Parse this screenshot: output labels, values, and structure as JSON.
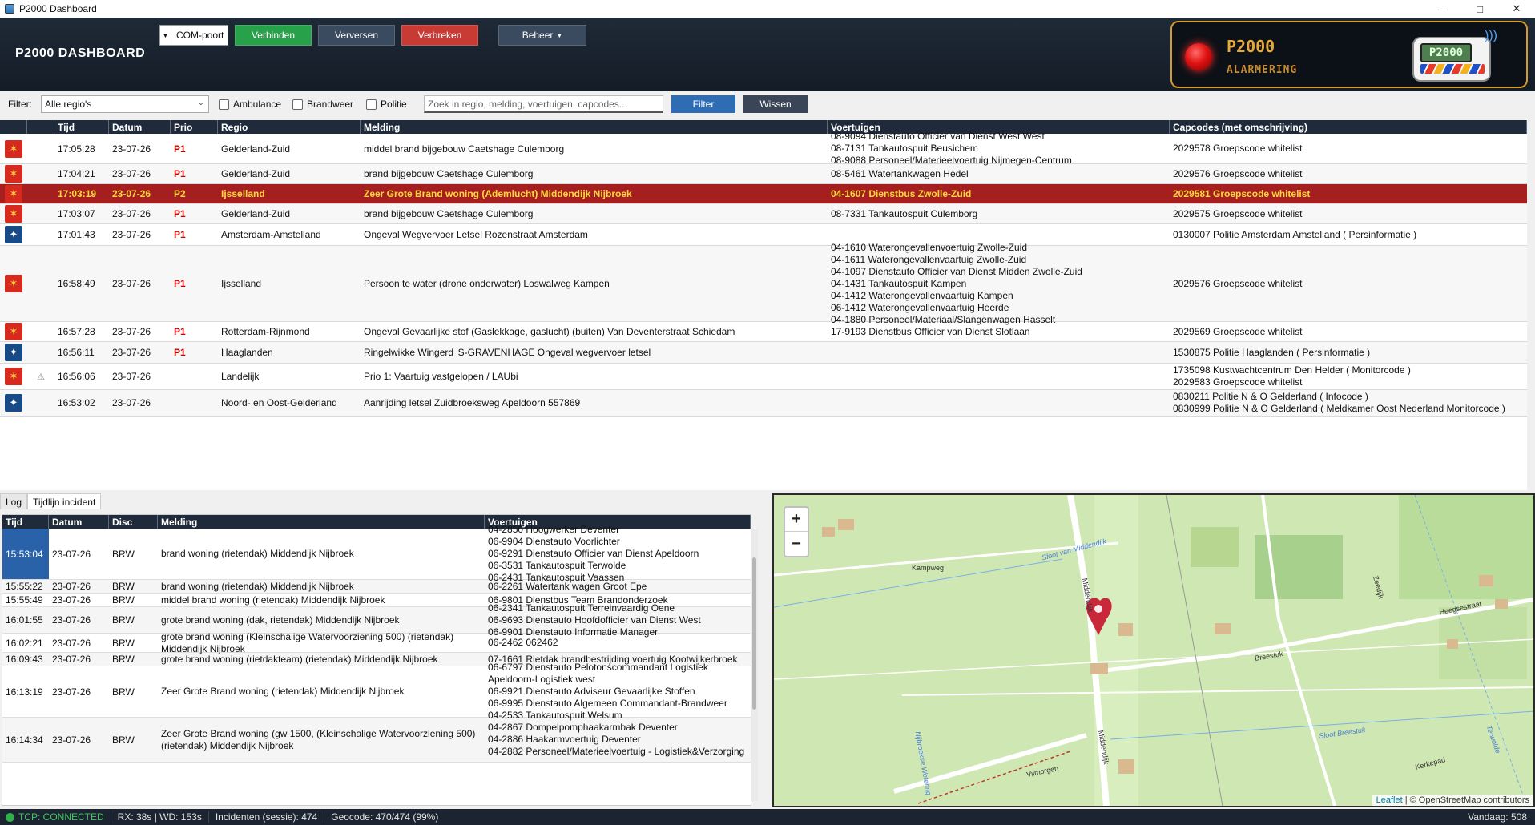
{
  "window": {
    "title": "P2000 Dashboard",
    "controls": [
      "—",
      "□",
      "✕"
    ]
  },
  "header": {
    "brand": "P2000  DASHBOARD",
    "com_port": "COM-poort",
    "btn_connect": "Verbinden",
    "btn_refresh": "Verversen",
    "btn_disconnect": "Verbreken",
    "btn_manage": "Beheer",
    "alarm_title": "P2000",
    "alarm_subtitle": "ALARMERING",
    "pager_screen": "P2000"
  },
  "filter": {
    "label": "Filter:",
    "region_select": "Alle regio's",
    "chk_ambulance": "Ambulance",
    "chk_brandweer": "Brandweer",
    "chk_politie": "Politie",
    "search_placeholder": "Zoek in regio, melding, voertuigen, capcodes...",
    "btn_filter": "Filter",
    "btn_clear": "Wissen"
  },
  "main_table": {
    "headers": {
      "time": "Tijd",
      "date": "Datum",
      "prio": "Prio",
      "region": "Regio",
      "message": "Melding",
      "vehicles": "Voertuigen",
      "capcodes": "Capcodes (met omschrijving)"
    },
    "rows": [
      {
        "icon": "brandweer-icon",
        "time": "17:05:28",
        "date": "23-07-26",
        "prio": "P1",
        "region": "Gelderland-Zuid",
        "message": "middel brand bijgebouw Caetshage Culemborg",
        "vehicles": [
          "08-9094 Dienstauto Officier van Dienst West West",
          "08-7131 Tankautospuit Beusichem",
          "08-9088 Personeel/Materieelvoertuig Nijmegen-Centrum"
        ],
        "capcodes": [
          "2029578 Groepscode whitelist"
        ]
      },
      {
        "icon": "brandweer-icon",
        "time": "17:04:21",
        "date": "23-07-26",
        "prio": "P1",
        "region": "Gelderland-Zuid",
        "message": "brand bijgebouw Caetshage Culemborg",
        "vehicles": [
          "08-5461 Watertankwagen Hedel"
        ],
        "capcodes": [
          "2029576 Groepscode whitelist"
        ]
      },
      {
        "icon": "brandweer-icon",
        "time": "17:03:19",
        "date": "23-07-26",
        "prio": "P2",
        "region": "Ijsselland",
        "message": "Zeer Grote Brand woning (Ademlucht) Middendijk Nijbroek",
        "vehicles": [
          "04-1607 Dienstbus Zwolle-Zuid"
        ],
        "capcodes": [
          "2029581 Groepscode whitelist"
        ]
      },
      {
        "icon": "brandweer-icon",
        "time": "17:03:07",
        "date": "23-07-26",
        "prio": "P1",
        "region": "Gelderland-Zuid",
        "message": "brand bijgebouw Caetshage Culemborg",
        "vehicles": [
          "08-7331 Tankautospuit Culemborg"
        ],
        "capcodes": [
          "2029575 Groepscode whitelist"
        ]
      },
      {
        "icon": "politie-icon",
        "time": "17:01:43",
        "date": "23-07-26",
        "prio": "P1",
        "region": "Amsterdam-Amstelland",
        "message": "Ongeval Wegvervoer Letsel Rozenstraat Amsterdam",
        "vehicles": [],
        "capcodes": [
          "0130007 Politie Amsterdam Amstelland ( Persinformatie )"
        ]
      },
      {
        "icon": "brandweer-icon",
        "time": "16:58:49",
        "date": "23-07-26",
        "prio": "P1",
        "region": "Ijsselland",
        "message": "Persoon te water (drone onderwater) Loswalweg Kampen",
        "vehicles": [
          "04-1610 Waterongevallenvoertuig Zwolle-Zuid",
          "04-1611 Waterongevallenvaartuig Zwolle-Zuid",
          "04-1097 Dienstauto Officier van Dienst Midden Zwolle-Zuid",
          "04-1431 Tankautospuit Kampen",
          "04-1412 Waterongevallenvaartuig Kampen",
          "06-1412 Waterongevallenvaartuig Heerde",
          "04-1880 Personeel/Materiaal/Slangenwagen Hasselt"
        ],
        "capcodes": [
          "2029576 Groepscode whitelist"
        ]
      },
      {
        "icon": "brandweer-icon",
        "time": "16:57:28",
        "date": "23-07-26",
        "prio": "P1",
        "region": "Rotterdam-Rijnmond",
        "message": "Ongeval Gevaarlijke stof (Gaslekkage, gaslucht) (buiten) Van Deventerstraat Schiedam",
        "vehicles": [
          "17-9193 Dienstbus Officier van Dienst Slotlaan"
        ],
        "capcodes": [
          "2029569 Groepscode whitelist"
        ]
      },
      {
        "icon": "politie-icon",
        "time": "16:56:11",
        "date": "23-07-26",
        "prio": "P1",
        "region": "Haaglanden",
        "message": "Ringelwikke Wingerd 'S-GRAVENHAGE Ongeval wegvervoer letsel",
        "vehicles": [],
        "capcodes": [
          "1530875 Politie Haaglanden ( Persinformatie )"
        ]
      },
      {
        "icon": "brandweer-icon",
        "warn": "⚠",
        "time": "16:56:06",
        "date": "23-07-26",
        "prio": "",
        "region": "Landelijk",
        "message": "Prio 1: Vaartuig vastgelopen / LAUbi",
        "vehicles": [],
        "capcodes": [
          "1735098 Kustwachtcentrum Den Helder ( Monitorcode )",
          "2029583 Groepscode whitelist"
        ]
      },
      {
        "icon": "politie-icon",
        "time": "16:53:02",
        "date": "23-07-26",
        "prio": "",
        "region": "Noord- en Oost-Gelderland",
        "message": "Aanrijding letsel Zuidbroeksweg Apeldoorn 557869",
        "vehicles": [],
        "capcodes": [
          "0830211 Politie N & O Gelderland ( Infocode )",
          "0830999 Politie N & O Gelderland ( Meldkamer Oost Nederland Monitorcode )"
        ]
      }
    ]
  },
  "tabs": [
    "Log",
    "Tijdlijn incident"
  ],
  "timeline": {
    "headers": {
      "time": "Tijd",
      "date": "Datum",
      "disc": "Disc",
      "message": "Melding",
      "vehicles": "Voertuigen"
    },
    "rows": [
      {
        "time": "15:53:04",
        "date": "23-07-26",
        "disc": "BRW",
        "message": [
          "brand woning (rietendak) Middendijk Nijbroek"
        ],
        "vehicles": [
          "04-2850 Hoogwerker Deventer",
          "06-9904 Dienstauto Voorlichter",
          "06-9291 Dienstauto Officier van Dienst Apeldoorn",
          "06-3531 Tankautospuit Terwolde",
          "06-2431 Tankautospuit Vaassen"
        ]
      },
      {
        "time": "15:55:22",
        "date": "23-07-26",
        "disc": "BRW",
        "message": [
          "brand woning (rietendak) Middendijk Nijbroek"
        ],
        "vehicles": [
          "06-2261 Watertank wagen Groot Epe"
        ]
      },
      {
        "time": "15:55:49",
        "date": "23-07-26",
        "disc": "BRW",
        "message": [
          "middel brand woning (rietendak) Middendijk Nijbroek"
        ],
        "vehicles": [
          "06-9801 Dienstbus Team Brandonderzoek"
        ]
      },
      {
        "time": "16:01:55",
        "date": "23-07-26",
        "disc": "BRW",
        "message": [
          "grote brand woning (dak, rietendak) Middendijk Nijbroek"
        ],
        "vehicles": [
          "06-2341 Tankautospuit Terreinvaardig Oene",
          "06-9693 Dienstauto Hoofdofficier van Dienst West",
          "06-9901 Dienstauto Informatie Manager"
        ]
      },
      {
        "time": "16:02:21",
        "date": "23-07-26",
        "disc": "BRW",
        "message": [
          "grote brand woning (Kleinschalige Watervoorziening 500) (rietendak)",
          "Middendijk Nijbroek"
        ],
        "vehicles": [
          "06-2462 062462"
        ]
      },
      {
        "time": "16:09:43",
        "date": "23-07-26",
        "disc": "BRW",
        "message": [
          "grote brand woning (rietdakteam) (rietendak) Middendijk Nijbroek"
        ],
        "vehicles": [
          "07-1661 Rietdak brandbestrijding voertuig Kootwijkerbroek"
        ]
      },
      {
        "time": "16:13:19",
        "date": "23-07-26",
        "disc": "BRW",
        "message": [
          "Zeer Grote Brand woning (rietendak) Middendijk Nijbroek"
        ],
        "vehicles": [
          "06-6797 Dienstauto  Pelotonscommandant Logistiek",
          "Apeldoorn-Logistiek west",
          "06-9921 Dienstauto Adviseur Gevaarlijke Stoffen",
          "06-9995 Dienstauto Algemeen Commandant-Brandweer",
          "04-2533 Tankautospuit Welsum"
        ]
      },
      {
        "time": "16:14:34",
        "date": "23-07-26",
        "disc": "BRW",
        "message": [
          "Zeer Grote Brand woning (gw 1500, (Kleinschalige Watervoorziening 500)",
          "(rietendak) Middendijk Nijbroek"
        ],
        "vehicles": [
          "04-2867 Dompelpomphaakarmbak Deventer",
          "04-2886 Haakarmvoertuig Deventer",
          "04-2882 Personeel/Materieelvoertuig - Logistiek&Verzorging"
        ]
      }
    ]
  },
  "map": {
    "zoom_in": "+",
    "zoom_out": "−",
    "attribution_leaflet": "Leaflet",
    "attribution_rest": " | © OpenStreetMap contributors",
    "labels": [
      "Kampweg",
      "Sloot van Middendijk",
      "Middendijk",
      "Breestuk",
      "Heegsestraat",
      "Zeedijk",
      "Sloot Breestuk",
      "Kerkepad",
      "Vilmorgen",
      "Middendijk",
      "Nijbroekse Wetering",
      "Terwolde"
    ]
  },
  "status": {
    "tcp": "TCP: CONNECTED",
    "rx": "RX: 38s | WD: 153s",
    "incidents": "Incidenten (sessie): 474",
    "geocode": "Geocode: 470/474 (99%)",
    "today": "Vandaag: 508"
  },
  "colors": {
    "header_bg": "#1b2430",
    "selected_row": "#a51f1f",
    "selected_text": "#ffd83d",
    "prio_text": "#cc0000",
    "connect_btn": "#27a14a",
    "disconnect_btn": "#c83a34"
  }
}
